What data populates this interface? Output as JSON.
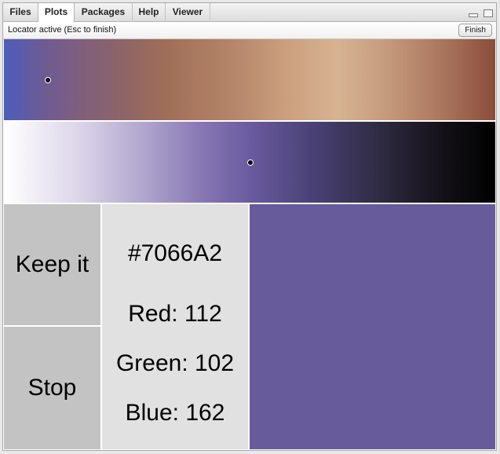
{
  "tabs": [
    {
      "label": "Files",
      "active": false
    },
    {
      "label": "Plots",
      "active": true
    },
    {
      "label": "Packages",
      "active": false
    },
    {
      "label": "Help",
      "active": false
    },
    {
      "label": "Viewer",
      "active": false
    }
  ],
  "toolbar": {
    "status": "Locator active (Esc to finish)",
    "finish_label": "Finish"
  },
  "plot": {
    "keep_label": "Keep it",
    "stop_label": "Stop",
    "hex": "#7066A2",
    "red": "Red: 112",
    "green": "Green: 102",
    "blue": "Blue: 162",
    "swatch_color": "#675b9b"
  },
  "icons": [
    "minimize-icon",
    "maximize-icon"
  ]
}
